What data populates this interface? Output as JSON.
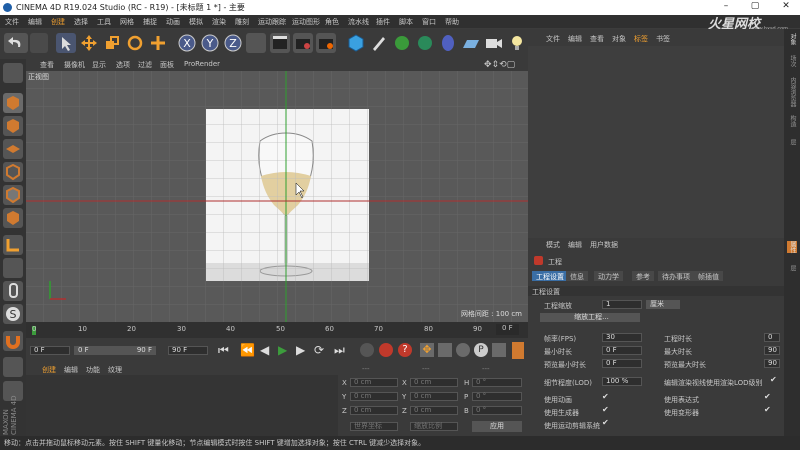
{
  "window": {
    "title": "CINEMA 4D R19.024 Studio (RC - R19) - [未标题 1 *] - 主要",
    "minimize": "–",
    "maximize": "▢",
    "close": "✕"
  },
  "watermark": "火星网校",
  "watermark_sub": "www.hxsd.com",
  "menu": [
    "文件",
    "编辑",
    "创建",
    "选择",
    "工具",
    "网格",
    "捕捉",
    "动画",
    "模拟",
    "渲染",
    "雕刻",
    "运动跟踪",
    "运动图形",
    "角色",
    "流水线",
    "插件",
    "脚本",
    "窗口",
    "帮助"
  ],
  "viewport": {
    "menu": [
      "查看",
      "摄像机",
      "显示",
      "选项",
      "过滤",
      "面板",
      "ProRender"
    ],
    "label": "正视图",
    "grid_info": "网格间距 : 100 cm"
  },
  "timeline": {
    "ticks": [
      "0",
      "10",
      "20",
      "30",
      "40",
      "50",
      "60",
      "70",
      "80",
      "90"
    ],
    "end_label": "0 F"
  },
  "transport": {
    "start": "0 F",
    "current": "0 F",
    "range_end": "90 F",
    "end": "90 F"
  },
  "material_manager": {
    "menu": [
      "创建",
      "编辑",
      "功能",
      "纹理"
    ]
  },
  "coords": {
    "headers": [
      "---",
      "---",
      "---"
    ],
    "rows": [
      {
        "a": "X",
        "av": "0 cm",
        "b": "X",
        "bv": "0 cm",
        "c": "H",
        "cv": "0 °"
      },
      {
        "a": "Y",
        "av": "0 cm",
        "b": "Y",
        "bv": "0 cm",
        "c": "P",
        "cv": "0 °"
      },
      {
        "a": "Z",
        "av": "0 cm",
        "b": "Z",
        "bv": "0 cm",
        "c": "B",
        "cv": "0 °"
      }
    ],
    "mode1": "世界坐标",
    "mode2": "缩放比例",
    "apply": "应用"
  },
  "object_manager": {
    "tabs": [
      "文件",
      "编辑",
      "查看",
      "对象",
      "标签",
      "书签"
    ]
  },
  "right_strip_tabs": [
    "对象",
    "场次",
    "内容浏览器",
    "构造",
    "层"
  ],
  "attr_strip_tabs": [
    "属性",
    "层"
  ],
  "attributes": {
    "menu": [
      "模式",
      "编辑",
      "用户数据"
    ],
    "object_name": "工程",
    "tabs": [
      "工程设置",
      "信息",
      "动力学",
      "参考",
      "待办事项",
      "帧插值"
    ],
    "section": "工程设置",
    "scale_label": "工程缩放",
    "scale_value": "1",
    "scale_unit": "厘米",
    "scale_button": "缩放工程...",
    "fps_label": "帧率(FPS)",
    "fps_value": "30",
    "duration_label": "工程时长",
    "duration_value": "0",
    "min_time_label": "最小时长",
    "min_time_value": "0 F",
    "max_time_label": "最大时长",
    "max_time_value": "90",
    "preview_min_label": "预览最小时长",
    "preview_min_value": "0 F",
    "preview_max_label": "预览最大时长",
    "preview_max_value": "90",
    "lod_label": "细节程度(LOD)",
    "lod_value": "100 %",
    "lod_render_label": "编辑渲染视线使用渲染LOD级别",
    "use_anim": "使用动画",
    "use_expr": "使用表达式",
    "use_gen": "使用生成器",
    "use_deform": "使用变形器",
    "use_motion": "使用运动剪辑系统",
    "check": "✔"
  },
  "status": "移动：点击并拖动鼠标移动元素。按住 SHIFT 键量化移动；节点编辑模式时按住 SHIFT 键增加选择对象；按住 CTRL 键减少选择对象。",
  "maxon": "MAXON\nCINEMA 4D",
  "colors": {
    "accent": "#3a6ea5",
    "play": "#3c9c3c",
    "record": "#c0392b",
    "axis_x": "#b03030",
    "axis_y": "#30a030"
  }
}
